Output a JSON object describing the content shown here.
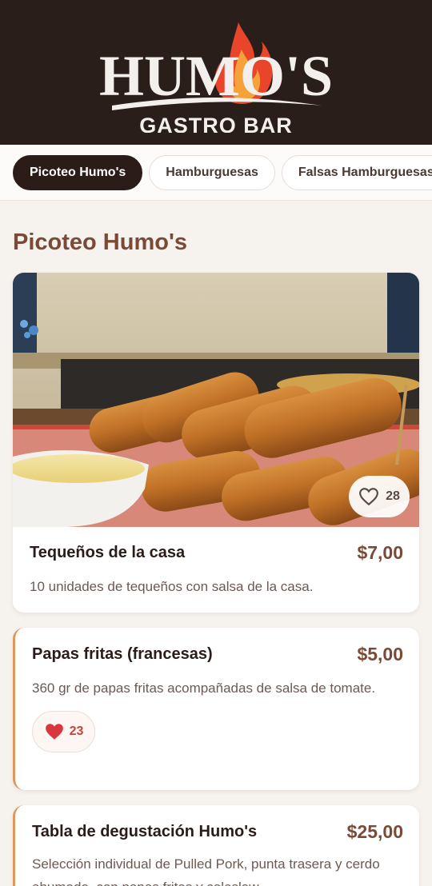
{
  "brand": {
    "logo_main": "HUMO'S",
    "logo_sub": "GASTRO BAR"
  },
  "tabs": [
    {
      "label": "Picoteo Humo's",
      "active": true
    },
    {
      "label": "Hamburguesas",
      "active": false
    },
    {
      "label": "Falsas Hamburguesas",
      "active": false
    }
  ],
  "section": {
    "title": "Picoteo Humo's"
  },
  "items": [
    {
      "name": "Tequeños de la casa",
      "price": "$7,00",
      "description": "10 unidades de tequeños con salsa de la casa.",
      "likes": "28",
      "liked": false,
      "image": "tequenos-photo"
    },
    {
      "name": "Papas fritas (francesas)",
      "price": "$5,00",
      "description": "360 gr de papas fritas acompañadas de salsa de tomate.",
      "likes": "23",
      "liked": true
    },
    {
      "name": "Tabla de degustación Humo's",
      "price": "$25,00",
      "description": "Selección individual de Pulled Pork, punta trasera y cerdo ahumado, con papas fritas y coleslaw."
    }
  ],
  "colors": {
    "header_bg": "#2a1e1b",
    "accent": "#7a4a36",
    "flame": "#e8452a",
    "heart_active": "#d9363e",
    "card_border_accent": "#e0955a"
  },
  "icons": [
    "heart-outline-icon",
    "heart-filled-icon",
    "flame-icon"
  ]
}
